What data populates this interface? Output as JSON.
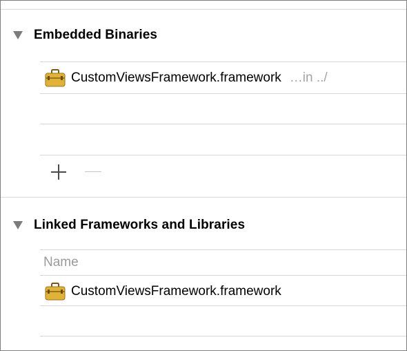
{
  "embedded_binaries": {
    "title": "Embedded Binaries",
    "items": [
      {
        "name": "CustomViewsFramework.framework",
        "location": "…in ../",
        "icon": "framework-toolbox-icon"
      }
    ],
    "add_icon": "plus-icon",
    "remove_icon": "minus-icon"
  },
  "linked_frameworks": {
    "title": "Linked Frameworks and Libraries",
    "column_header": "Name",
    "items": [
      {
        "name": "CustomViewsFramework.framework",
        "icon": "framework-toolbox-icon"
      }
    ]
  },
  "colors": {
    "icon_body": "#e0b23a",
    "icon_dark": "#7a5a12",
    "separator": "#d6d6d6",
    "secondary_text": "#a3a3a3"
  }
}
